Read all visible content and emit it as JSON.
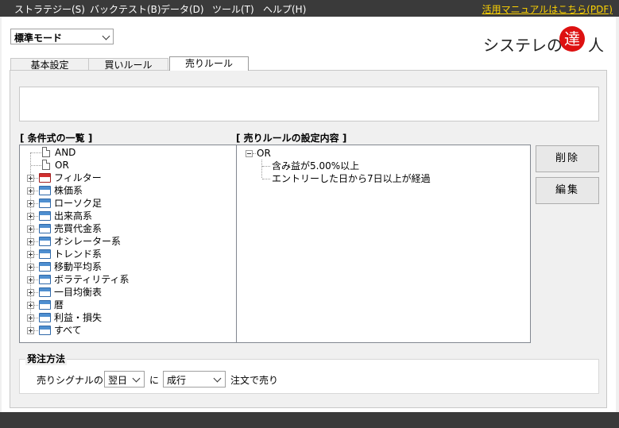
{
  "menu": {
    "items": [
      "ストラテジー(S)",
      "バックテスト(B)",
      "データ(D)",
      "ツール(T)",
      "ヘルプ(H)"
    ],
    "manual_link": "活用マニュアルはこちら(PDF)"
  },
  "mode_select": {
    "value": "標準モード"
  },
  "logo": {
    "text_left": "システレの",
    "circle_char": "達",
    "text_right": "人"
  },
  "tabs": [
    {
      "label": "基本設定",
      "active": false
    },
    {
      "label": "買いルール",
      "active": false
    },
    {
      "label": "売りルール",
      "active": true
    }
  ],
  "conditions": {
    "header": "[ 条件式の一覧 ]",
    "items": [
      {
        "label": "AND",
        "kind": "doc"
      },
      {
        "label": "OR",
        "kind": "doc"
      },
      {
        "label": "フィルター",
        "kind": "folder-red"
      },
      {
        "label": "株価系",
        "kind": "folder"
      },
      {
        "label": "ローソク足",
        "kind": "folder"
      },
      {
        "label": "出来高系",
        "kind": "folder"
      },
      {
        "label": "売買代金系",
        "kind": "folder"
      },
      {
        "label": "オシレーター系",
        "kind": "folder"
      },
      {
        "label": "トレンド系",
        "kind": "folder"
      },
      {
        "label": "移動平均系",
        "kind": "folder"
      },
      {
        "label": "ボラティリティ系",
        "kind": "folder"
      },
      {
        "label": "一目均衡表",
        "kind": "folder"
      },
      {
        "label": "暦",
        "kind": "folder"
      },
      {
        "label": "利益・損失",
        "kind": "folder"
      },
      {
        "label": "すべて",
        "kind": "folder"
      }
    ]
  },
  "rule_settings": {
    "header": "[ 売りルールの設定内容 ]",
    "root": "OR",
    "children": [
      "含み益が5.00%以上",
      "エントリーした日から7日以上が経過"
    ]
  },
  "buttons": {
    "delete": "削除",
    "edit": "編集"
  },
  "order": {
    "title": "発注方法",
    "prefix": "売りシグナルの",
    "timing": "翌日",
    "particle": "に",
    "method": "成行",
    "suffix": "注文で売り"
  }
}
